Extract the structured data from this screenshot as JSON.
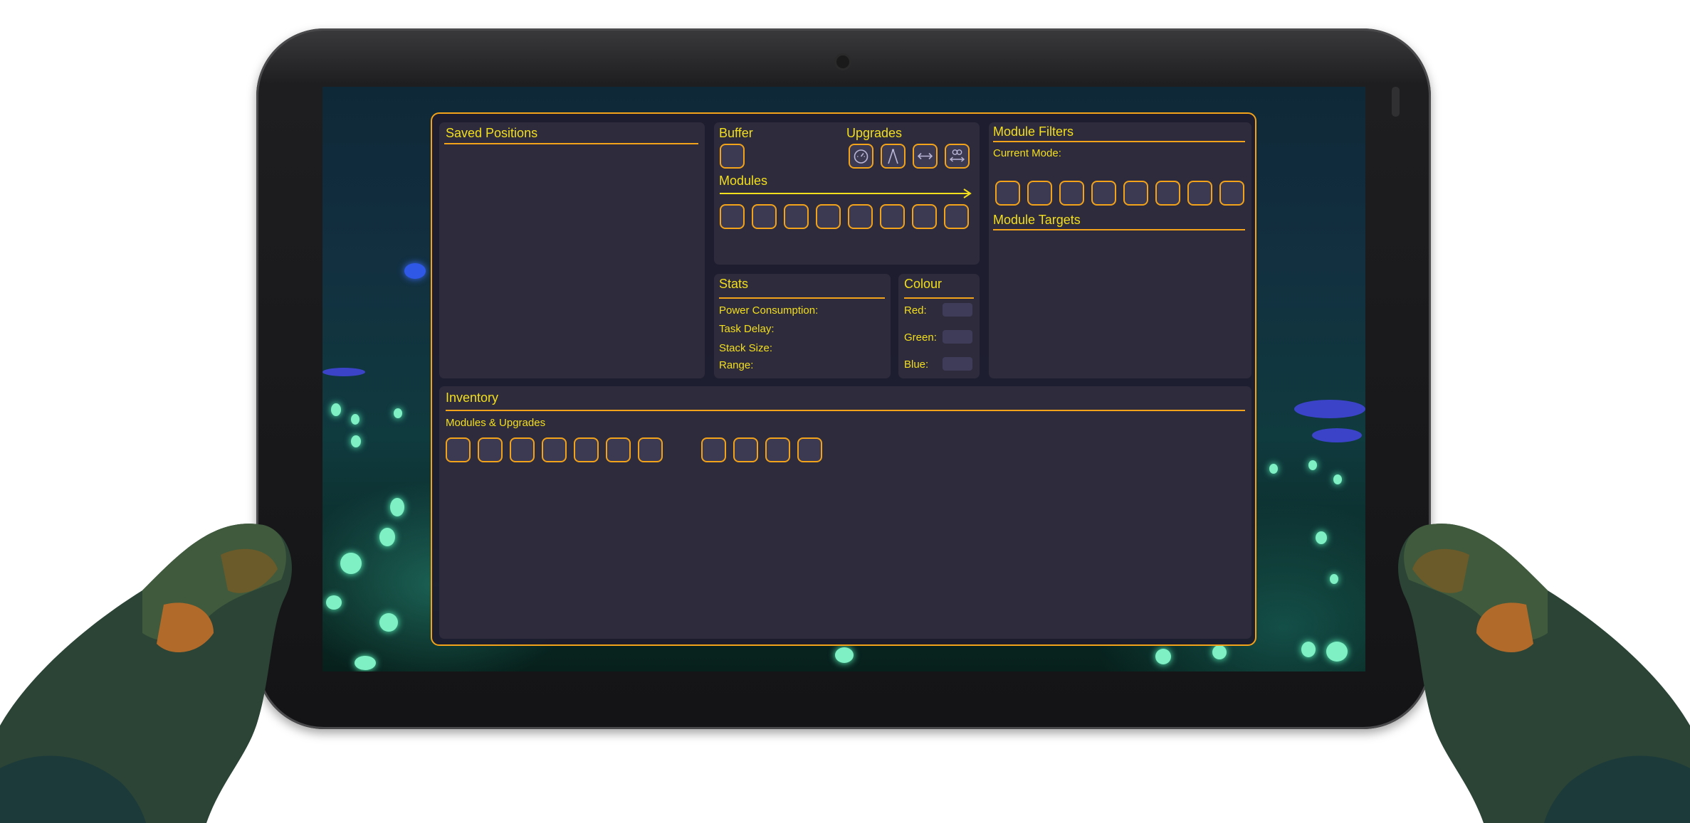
{
  "saved_positions": {
    "title": "Saved Positions"
  },
  "buffer": {
    "title": "Buffer"
  },
  "upgrades": {
    "title": "Upgrades",
    "icons": [
      "speedometer-icon",
      "compass-icon",
      "range-arrows-icon",
      "infinite-range-icon"
    ]
  },
  "modules": {
    "title": "Modules",
    "slot_count": 8
  },
  "module_filters": {
    "title": "Module Filters",
    "current_mode_label": "Current Mode:",
    "slot_count": 8
  },
  "module_targets": {
    "title": "Module Targets"
  },
  "stats": {
    "title": "Stats",
    "items": [
      "Power Consumption:",
      "Task Delay:",
      "Stack Size:",
      "Range:"
    ]
  },
  "colour": {
    "title": "Colour",
    "channels": [
      "Red:",
      "Green:",
      "Blue:"
    ]
  },
  "inventory": {
    "title": "Inventory",
    "subtitle": "Modules & Upgrades",
    "module_slot_count": 7,
    "upgrade_slot_count": 4
  },
  "colors": {
    "accent": "#f2a31a",
    "text": "#f3df1c",
    "panel": "#2e2b3d",
    "slot": "#3c3952"
  }
}
